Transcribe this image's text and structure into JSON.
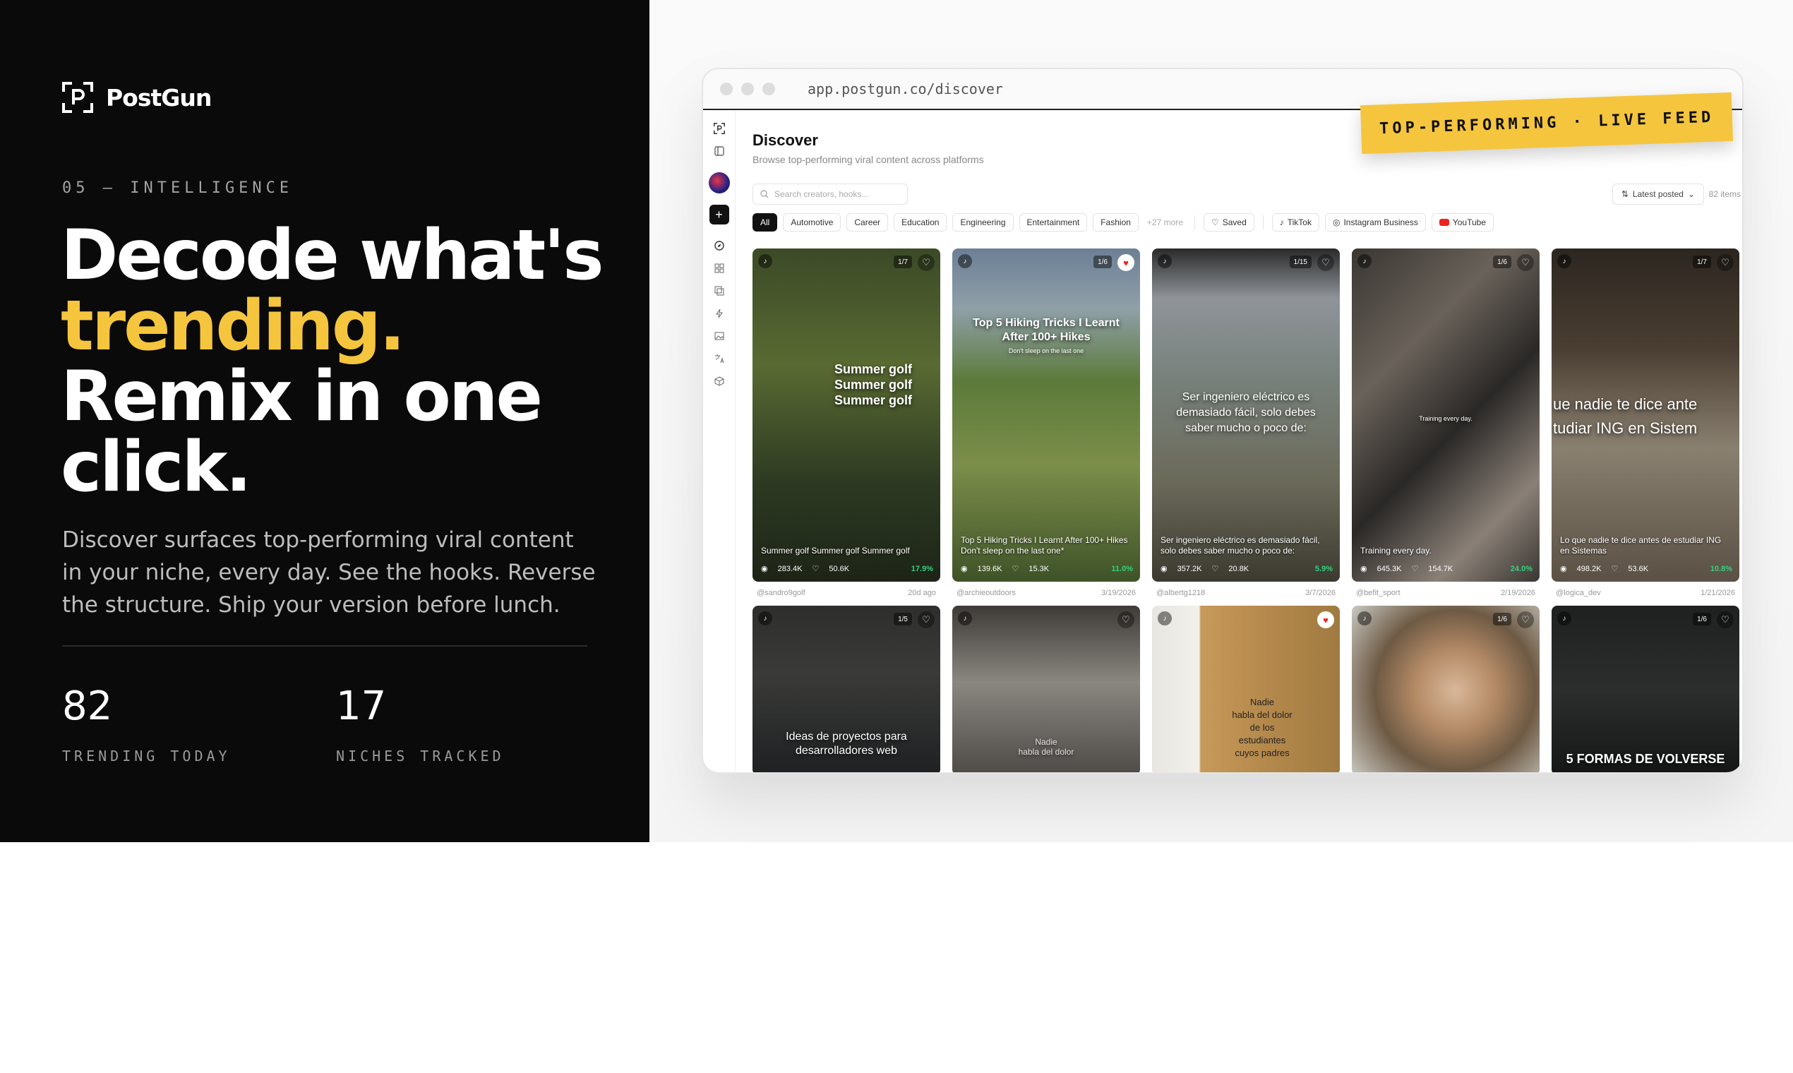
{
  "brand": {
    "name": "PostGun"
  },
  "eyebrow": "05 — INTELLIGENCE",
  "headline": {
    "line1": "Decode what's",
    "line2": "trending.",
    "line3": "Remix in one",
    "line4": "click."
  },
  "subtext": "Discover surfaces top-performing viral content in your niche, every day. See the hooks. Reverse the structure. Ship your version before lunch.",
  "stats": [
    {
      "value": "82",
      "label": "TRENDING TODAY"
    },
    {
      "value": "17",
      "label": "NICHES TRACKED"
    }
  ],
  "browser": {
    "url": "app.postgun.co/discover"
  },
  "badge": "TOP-PERFORMING · LIVE FEED",
  "app": {
    "title": "Discover",
    "subtitle": "Browse top-performing viral content across platforms",
    "search_placeholder": "Search creators, hooks...",
    "sort_label": "Latest posted",
    "count": "82 items",
    "chips": [
      "All",
      "Automotive",
      "Career",
      "Education",
      "Engineering",
      "Entertainment",
      "Fashion"
    ],
    "more_chips": "+27 more",
    "saved": "Saved",
    "platforms": [
      "TikTok",
      "Instagram Business",
      "YouTube"
    ]
  },
  "colors": {
    "accent": "#f5c53e",
    "dark": "#0a0a0a",
    "growth": "#35d07f",
    "liked": "#e22222"
  },
  "cards_row1": [
    {
      "pager": "1/7",
      "overlay": "Summer golf\nSummer golf\nSummer golf",
      "overlay_sub": "",
      "caption": "Summer golf Summer golf Summer golf",
      "views": "283.4K",
      "likes": "50.6K",
      "growth": "17.9%",
      "handle": "@sandro9golf",
      "date": "20d ago",
      "liked": false
    },
    {
      "pager": "1/6",
      "overlay": "Top 5 Hiking Tricks I Learnt\nAfter 100+ Hikes",
      "overlay_sub": "Don't sleep on the last one",
      "caption": "Top 5 Hiking Tricks I Learnt After 100+ Hikes Don't sleep on the last one*",
      "views": "139.6K",
      "likes": "15.3K",
      "growth": "11.0%",
      "handle": "@archieoutdoors",
      "date": "3/19/2026",
      "liked": true
    },
    {
      "pager": "1/15",
      "overlay": "Ser ingeniero eléctrico es\ndemasiado fácil, solo debes\nsaber mucho o poco de:",
      "overlay_sub": "",
      "caption": "Ser ingeniero eléctrico es demasiado fácil, solo debes saber mucho o poco de:",
      "views": "357.2K",
      "likes": "20.8K",
      "growth": "5.9%",
      "handle": "@albertg1218",
      "date": "3/7/2026",
      "liked": false
    },
    {
      "pager": "1/6",
      "overlay": "",
      "overlay_sub": "Training every day.",
      "caption": "Training every day.",
      "views": "645.3K",
      "likes": "154.7K",
      "growth": "24.0%",
      "handle": "@befit_sport",
      "date": "2/19/2026",
      "liked": false
    },
    {
      "pager": "1/7",
      "overlay": "ue nadie te dice ante\ntudiar ING en Sistem",
      "overlay_sub": "",
      "caption": "Lo que nadie te dice antes de estudiar ING en Sistemas",
      "views": "498.2K",
      "likes": "53.6K",
      "growth": "10.8%",
      "handle": "@logica_dev",
      "date": "1/21/2026",
      "liked": false
    }
  ],
  "cards_row2": [
    {
      "pager": "1/5",
      "overlay": "Ideas de proyectos para\ndesarrolladores web",
      "liked": false
    },
    {
      "pager": "",
      "overlay": "Nadie\nhabla del dolor",
      "liked": false
    },
    {
      "pager": "",
      "overlay": "Nadie\nhabla del dolor\nde los\nestudiantes\ncuyos padres",
      "liked": true
    },
    {
      "pager": "1/6",
      "overlay": "",
      "liked": false
    },
    {
      "pager": "1/6",
      "overlay": "5 FORMAS DE VOLVERSE",
      "liked": false
    }
  ]
}
